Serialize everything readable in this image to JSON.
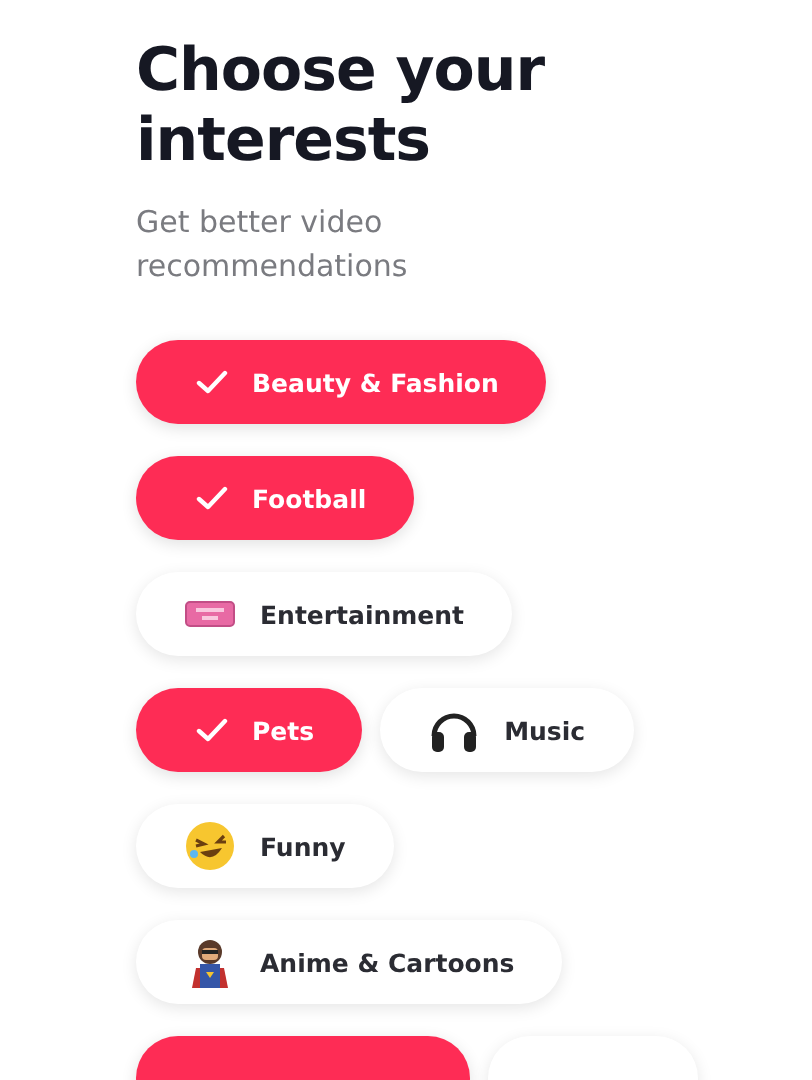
{
  "title": "Choose your interests",
  "subtitle": "Get better video recommendations",
  "rows": [
    {
      "chips": [
        {
          "label": "Beauty & Fashion",
          "selected": true,
          "kind": "check"
        }
      ]
    },
    {
      "chips": [
        {
          "label": "Football",
          "selected": true,
          "kind": "check"
        }
      ]
    },
    {
      "chips": [
        {
          "label": "Entertainment",
          "selected": false,
          "kind": "ticket"
        }
      ]
    },
    {
      "chips": [
        {
          "label": "Pets",
          "selected": true,
          "kind": "check"
        },
        {
          "label": "Music",
          "selected": false,
          "kind": "headphones"
        }
      ]
    },
    {
      "chips": [
        {
          "label": "Funny",
          "selected": false,
          "kind": "laughing"
        }
      ]
    },
    {
      "chips": [
        {
          "label": "Anime & Cartoons",
          "selected": false,
          "kind": "hero"
        }
      ]
    },
    {
      "chips": [
        {
          "selected": true,
          "kind": "hidden"
        },
        {
          "selected": false,
          "kind": "hidden"
        }
      ]
    }
  ]
}
